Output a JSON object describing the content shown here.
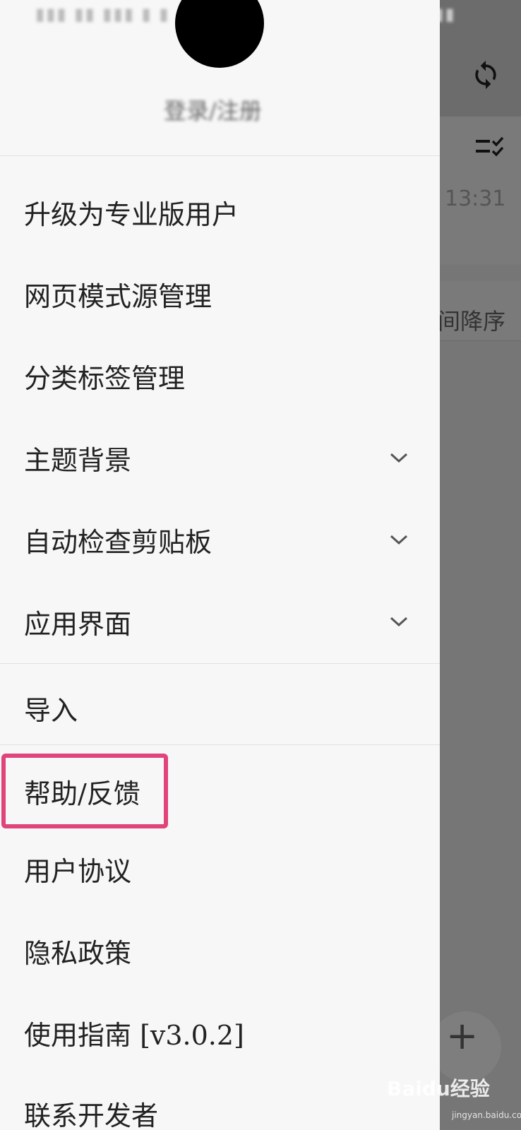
{
  "background_app": {
    "time": "13:31",
    "sort_label": "间降序",
    "fab_label": "+",
    "sync_icon": "sync-icon",
    "checklist_icon": "checklist-icon"
  },
  "drawer": {
    "login_label": "登录/注册",
    "menu": [
      {
        "label": "升级为专业版用户",
        "chevron": false
      },
      {
        "label": "网页模式源管理",
        "chevron": false
      },
      {
        "label": "分类标签管理",
        "chevron": false
      },
      {
        "label": "主题背景",
        "chevron": true
      },
      {
        "label": "自动检查剪贴板",
        "chevron": true
      },
      {
        "label": "应用界面",
        "chevron": true
      },
      {
        "label": "导入",
        "chevron": false
      },
      {
        "label": "帮助/反馈",
        "chevron": false
      },
      {
        "label": "用户协议",
        "chevron": false
      },
      {
        "label": "隐私政策",
        "chevron": false
      },
      {
        "label": "使用指南 [v3.0.2]",
        "chevron": false
      },
      {
        "label": "联系开发者",
        "chevron": false
      }
    ]
  },
  "watermark": {
    "text": "Baidu经验",
    "sub": "jingyan.baidu.com"
  },
  "colors": {
    "highlight": "#e0447a",
    "drawer_bg": "#f7f7f7",
    "scrim": "#767676"
  }
}
